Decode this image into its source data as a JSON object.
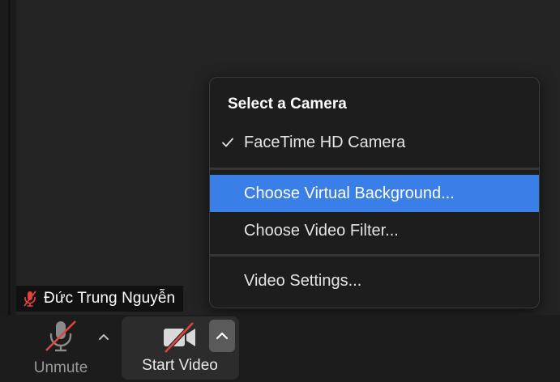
{
  "participant": {
    "name": "Đức Trung Nguyễn"
  },
  "toolbar": {
    "unmute_label": "Unmute",
    "start_video_label": "Start Video"
  },
  "camera_menu": {
    "title": "Select a Camera",
    "items": [
      {
        "label": "FaceTime HD Camera",
        "checked": true
      },
      {
        "label": "Choose Virtual Background...",
        "highlighted": true
      },
      {
        "label": "Choose Video Filter..."
      },
      {
        "label": "Video Settings..."
      }
    ]
  },
  "colors": {
    "highlight": "#3a7fe8",
    "muted_red": "#e0443c",
    "background": "#202020"
  },
  "icons": {
    "muted_mic": "mic-off-icon",
    "video_off": "video-off-icon",
    "caret": "chevron-up-icon",
    "check": "checkmark-icon"
  }
}
